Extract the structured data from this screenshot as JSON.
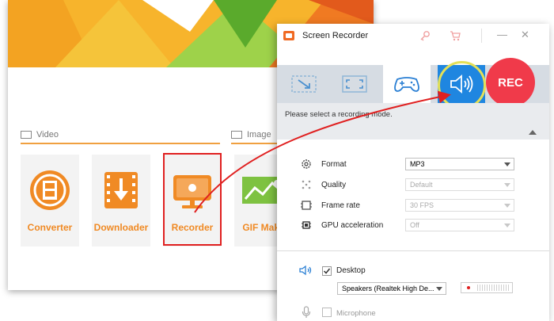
{
  "main_window": {
    "sections": [
      {
        "label": "Video",
        "icon": "film-icon"
      },
      {
        "label": "Image",
        "icon": "picture-icon"
      }
    ],
    "tools": [
      {
        "label": "Converter",
        "icon": "film-converter-icon"
      },
      {
        "label": "Downloader",
        "icon": "download-icon"
      },
      {
        "label": "Recorder",
        "icon": "screen-recorder-icon",
        "highlighted": true
      },
      {
        "label": "GIF Make",
        "icon": "gif-maker-icon"
      }
    ]
  },
  "recorder": {
    "title": "Screen Recorder",
    "titlebar_icons": [
      "key-icon",
      "cart-icon",
      "minimize-icon",
      "close-icon"
    ],
    "minimize_symbol": "—",
    "close_symbol": "✕",
    "modes": [
      {
        "name": "custom-region-icon",
        "active": false
      },
      {
        "name": "fullscreen-icon",
        "active": false
      },
      {
        "name": "game-controller-icon",
        "active": false
      },
      {
        "name": "audio-only-icon",
        "active": true
      }
    ],
    "rec_label": "REC",
    "hint": "Please select a recording mode.",
    "options": [
      {
        "label": "Format",
        "value": "MP3",
        "enabled": true,
        "icon": "format-gear-icon"
      },
      {
        "label": "Quality",
        "value": "Default",
        "enabled": false,
        "icon": "quality-icon"
      },
      {
        "label": "Frame rate",
        "value": "30 FPS",
        "enabled": false,
        "icon": "film-strip-icon"
      },
      {
        "label": "GPU acceleration",
        "value": "Off",
        "enabled": false,
        "icon": "chip-icon"
      }
    ],
    "audio": {
      "desktop_label": "Desktop",
      "desktop_checked": true,
      "desktop_device": "Speakers (Realtek High De...",
      "microphone_label": "Microphone",
      "microphone_checked": false
    }
  },
  "colors": {
    "accent_orange": "#f08a24",
    "highlight_red": "#e02020",
    "active_blue": "#1f86e0",
    "rec_red": "#f03a4a",
    "ring_yellow": "#e4e058"
  }
}
